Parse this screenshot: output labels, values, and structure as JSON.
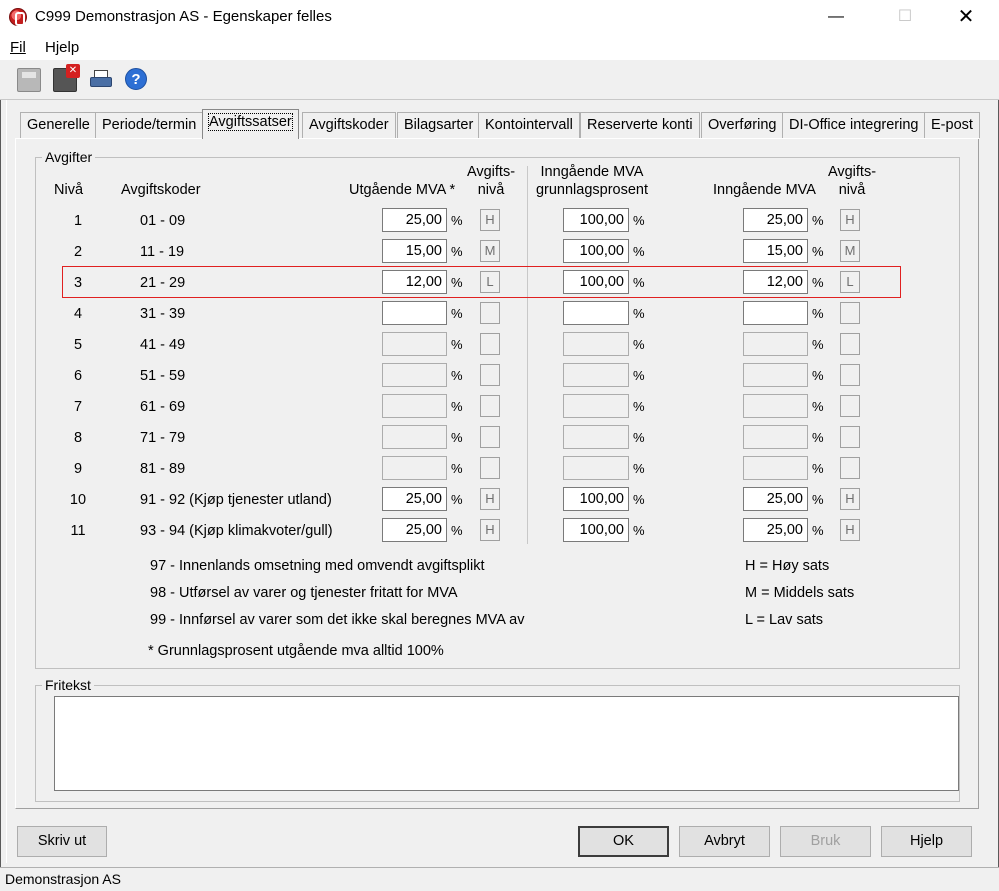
{
  "window": {
    "title": "C999 Demonstrasjon AS - Egenskaper felles",
    "min": "—",
    "max": "☐",
    "close": "✕"
  },
  "menu": [
    {
      "label": "Fil"
    },
    {
      "label": "Hjelp"
    }
  ],
  "tabs": [
    "Generelle",
    "Periode/termin",
    "Avgiftssatser",
    "Avgiftskoder",
    "Bilagsarter",
    "Kontointervall",
    "Reserverte konti",
    "Overføring",
    "DI-Office integrering",
    "E-post"
  ],
  "avgifter": {
    "group_label": "Avgifter",
    "headers": {
      "niva": "Nivå",
      "koder": "Avgiftskoder",
      "utg": "Utgående MVA *",
      "avgniva1": "Avgifts-",
      "avgniva2": "nivå",
      "inng_grunn1": "Inngående MVA",
      "inng_grunn2": "grunnlagsprosent",
      "inng": "Inngående MVA"
    },
    "pct": "%",
    "rows": [
      {
        "niva": "1",
        "koder": "01 - 09",
        "utg": "25,00",
        "niva1": "H",
        "grunn": "100,00",
        "inng": "25,00",
        "niva2": "H"
      },
      {
        "niva": "2",
        "koder": "11 - 19",
        "utg": "15,00",
        "niva1": "M",
        "grunn": "100,00",
        "inng": "15,00",
        "niva2": "M"
      },
      {
        "niva": "3",
        "koder": "21 - 29",
        "utg": "12,00",
        "niva1": "L",
        "grunn": "100,00",
        "inng": "12,00",
        "niva2": "L"
      },
      {
        "niva": "4",
        "koder": "31 - 39",
        "utg": "",
        "niva1": "",
        "grunn": "",
        "inng": "",
        "niva2": ""
      },
      {
        "niva": "5",
        "koder": "41 - 49",
        "utg": "",
        "niva1": "",
        "grunn": "",
        "inng": "",
        "niva2": ""
      },
      {
        "niva": "6",
        "koder": "51 - 59",
        "utg": "",
        "niva1": "",
        "grunn": "",
        "inng": "",
        "niva2": ""
      },
      {
        "niva": "7",
        "koder": "61 - 69",
        "utg": "",
        "niva1": "",
        "grunn": "",
        "inng": "",
        "niva2": ""
      },
      {
        "niva": "8",
        "koder": "71 - 79",
        "utg": "",
        "niva1": "",
        "grunn": "",
        "inng": "",
        "niva2": ""
      },
      {
        "niva": "9",
        "koder": "81 - 89",
        "utg": "",
        "niva1": "",
        "grunn": "",
        "inng": "",
        "niva2": ""
      },
      {
        "niva": "10",
        "koder": "91 - 92  (Kjøp tjenester utland)",
        "utg": "25,00",
        "niva1": "H",
        "grunn": "100,00",
        "inng": "25,00",
        "niva2": "H"
      },
      {
        "niva": "11",
        "koder": "93 - 94  (Kjøp klimakvoter/gull)",
        "utg": "25,00",
        "niva1": "H",
        "grunn": "100,00",
        "inng": "25,00",
        "niva2": "H"
      }
    ],
    "notes": [
      "97 - Innenlands omsetning med omvendt avgiftsplikt",
      "98 - Utførsel av varer og tjenester fritatt for MVA",
      "99 - Innførsel av varer som det ikke skal beregnes MVA av"
    ],
    "legend": [
      "H = Høy sats",
      "M = Middels sats",
      "L = Lav sats"
    ],
    "footnote": "* Grunnlagsprosent utgående mva alltid 100%"
  },
  "fritekst": {
    "label": "Fritekst",
    "value": ""
  },
  "buttons": {
    "print": "Skriv ut",
    "ok": "OK",
    "cancel": "Avbryt",
    "apply": "Bruk",
    "help": "Hjelp"
  },
  "status": "Demonstrasjon AS"
}
